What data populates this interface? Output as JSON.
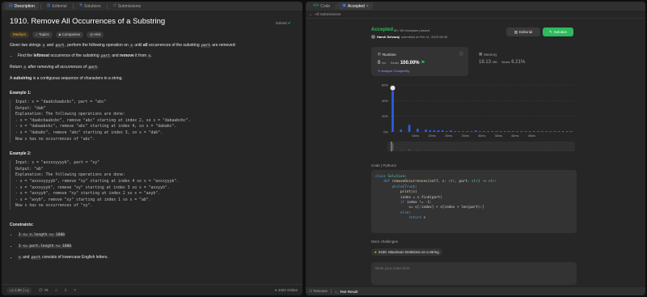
{
  "left_tabs": [
    {
      "label": "Description",
      "icon": "doc-icon",
      "active": true
    },
    {
      "label": "Editorial",
      "icon": "book-icon"
    },
    {
      "label": "Solutions",
      "icon": "flask-icon"
    },
    {
      "label": "Submissions",
      "icon": "history-icon"
    }
  ],
  "problem": {
    "title": "1910. Remove All Occurrences of a Substring",
    "solved_label": "Solved",
    "difficulty": "Medium",
    "tags": [
      "Topics",
      "Companies",
      "Hint"
    ],
    "intro_1": "Given two strings",
    "var_s": "s",
    "intro_2": "and",
    "var_part": "part",
    "intro_3": ", perform the following operation on",
    "intro_4": "until",
    "intro_all": "all",
    "intro_5": "occurrences of the substring",
    "intro_6": "are removed:",
    "bullet_1": "Find the",
    "bullet_leftmost": "leftmost",
    "bullet_2": "occurrence of the substring",
    "bullet_remove": "remove",
    "bullet_3": "it from",
    "return_1": "Return",
    "return_2": "after removing all occurrences of",
    "substring_word": "substring",
    "substring_def": "is a contiguous sequence of characters in a string.",
    "substring_prefix": "A",
    "example_1_title": "Example 1:",
    "example_1_lines": [
      "Input: s = \"daabcbaabcbc\", part = \"abc\"",
      "Output: \"dab\"",
      "Explanation: The following operations are done:",
      "- s = \"daabcbaabcbc\", remove \"abc\" starting at index 2, so s = \"dabaabcbc\".",
      "- s = \"dabaabcbc\", remove \"abc\" starting at index 4, so s = \"dababc\".",
      "- s = \"dababc\", remove \"abc\" starting at index 3, so s = \"dab\".",
      "Now s has no occurrences of \"abc\"."
    ],
    "example_2_title": "Example 2:",
    "example_2_lines": [
      "Input: s = \"axxxxyyyyb\", part = \"xy\"",
      "Output: \"ab\"",
      "Explanation: The following operations are done:",
      "- s = \"axxxxyyyyb\", remove \"xy\" starting at index 4 so s = \"axxxyyyb\".",
      "- s = \"axxxyyyb\", remove \"xy\" starting at index 3 so s = \"axxyyb\".",
      "- s = \"axxyyb\", remove \"xy\" starting at index 2 so s = \"axyb\".",
      "- s = \"axyb\", remove \"xy\" starting at index 1 so s = \"ab\".",
      "Now s has no occurrences of \"xy\"."
    ],
    "constraints_title": "Constraints:",
    "constraints": [
      "1 <= s.length <= 1000",
      "1 <= part.length <= 1000"
    ],
    "constraint_3": "consists of lowercase English letters.",
    "constraint_3_and": "and"
  },
  "left_bottom": {
    "likes": "1.9K",
    "comments": "76",
    "online": "4402 Online"
  },
  "right_tabs": [
    {
      "label": "Code",
      "icon": "code-icon"
    },
    {
      "label": "Accepted",
      "icon": "check-icon",
      "active": true
    }
  ],
  "submission": {
    "back_label": "All Submissions",
    "status": "Accepted",
    "passed": "80 / 80 testcases passed",
    "user": "Harsh Selvaraj",
    "submitted": "submitted at Feb 11, 2025 08:08",
    "editorial_label": "Editorial",
    "solution_label": "Solution",
    "runtime_label": "Runtime",
    "runtime_value": "0",
    "runtime_unit": "ms",
    "runtime_beats_label": "Beats",
    "runtime_beats": "100.00%",
    "analyze_label": "Analyze Complexity",
    "memory_label": "Memory",
    "memory_value": "18.13",
    "memory_unit": "MB",
    "memory_beats_label": "Beats",
    "memory_beats": "6.21%",
    "code_header": "Code | Python3",
    "more_label": "More challenges",
    "challenge": "2430. Maximum Deletions on a String",
    "notes_placeholder": "Write your notes here"
  },
  "right_bottom": {
    "testcase": "Testcase",
    "result": "Test Result"
  },
  "chart_data": {
    "type": "bar",
    "categories": [
      "0ms",
      "",
      "",
      "",
      "10ms",
      "",
      "",
      "",
      "15ms",
      "",
      "",
      "",
      "20ms",
      "",
      "",
      "",
      "25ms",
      "",
      "",
      "",
      "30ms",
      "",
      "",
      "",
      "35ms",
      "",
      "",
      "",
      "40ms",
      "",
      "",
      "",
      "45ms",
      "",
      "",
      "",
      "50ms",
      "",
      "",
      "",
      "55ms",
      "",
      "",
      ""
    ],
    "x_tick_labels": [
      "0ms",
      "10ms",
      "15ms",
      "20ms",
      "25ms",
      "30ms",
      "35ms",
      "40ms",
      "45ms",
      "50ms",
      "55ms"
    ],
    "values": [
      52,
      0,
      3,
      0,
      9,
      0,
      4,
      0,
      3,
      2,
      2,
      2,
      2,
      1,
      2,
      1,
      1,
      1,
      1,
      1,
      2,
      1,
      1,
      1,
      1,
      1,
      1,
      1,
      1,
      1,
      1,
      1,
      1,
      1,
      1,
      1,
      1,
      1,
      1,
      1,
      1,
      1,
      1,
      1
    ],
    "ylabel": "",
    "xlabel": "",
    "y_tick_labels": [
      "0%",
      "20%",
      "40%",
      "60%"
    ],
    "ylim": [
      0,
      60
    ],
    "highlight_index": 0,
    "bar_color": "#2563eb"
  },
  "code_lines": [
    [
      [
        "kw",
        "class "
      ],
      [
        "bi",
        "Solution"
      ],
      [
        "",
        ":"
      ]
    ],
    [
      [
        "",
        "    "
      ],
      [
        "kw",
        "def "
      ],
      [
        "fn",
        "removeOccurrences"
      ],
      [
        "",
        "(self, s: "
      ],
      [
        "bi",
        "str"
      ],
      [
        "",
        ", part: "
      ],
      [
        "bi",
        "str"
      ],
      [
        "",
        ") -> "
      ],
      [
        "bi",
        "str"
      ],
      [
        "",
        ":"
      ]
    ],
    [
      [
        "",
        "        "
      ],
      [
        "kw",
        "while"
      ],
      [
        "",
        "("
      ],
      [
        "kw",
        "True"
      ],
      [
        "",
        "):"
      ]
    ],
    [
      [
        "",
        "            "
      ],
      [
        "fn",
        "print"
      ],
      [
        "",
        "(s)"
      ]
    ],
    [
      [
        "",
        "            index = s.find(part)"
      ]
    ],
    [
      [
        "",
        "            "
      ],
      [
        "kw",
        "if "
      ],
      [
        "",
        "index != -1:"
      ]
    ],
    [
      [
        "",
        "                s= s[:index] + s[index + "
      ],
      [
        "fn",
        "len"
      ],
      [
        "",
        "(part):]"
      ]
    ],
    [
      [
        "",
        "            "
      ],
      [
        "kw",
        "else"
      ],
      [
        "",
        ":"
      ]
    ],
    [
      [
        "",
        "                "
      ],
      [
        "kw",
        "return "
      ],
      [
        "",
        "s"
      ]
    ]
  ]
}
